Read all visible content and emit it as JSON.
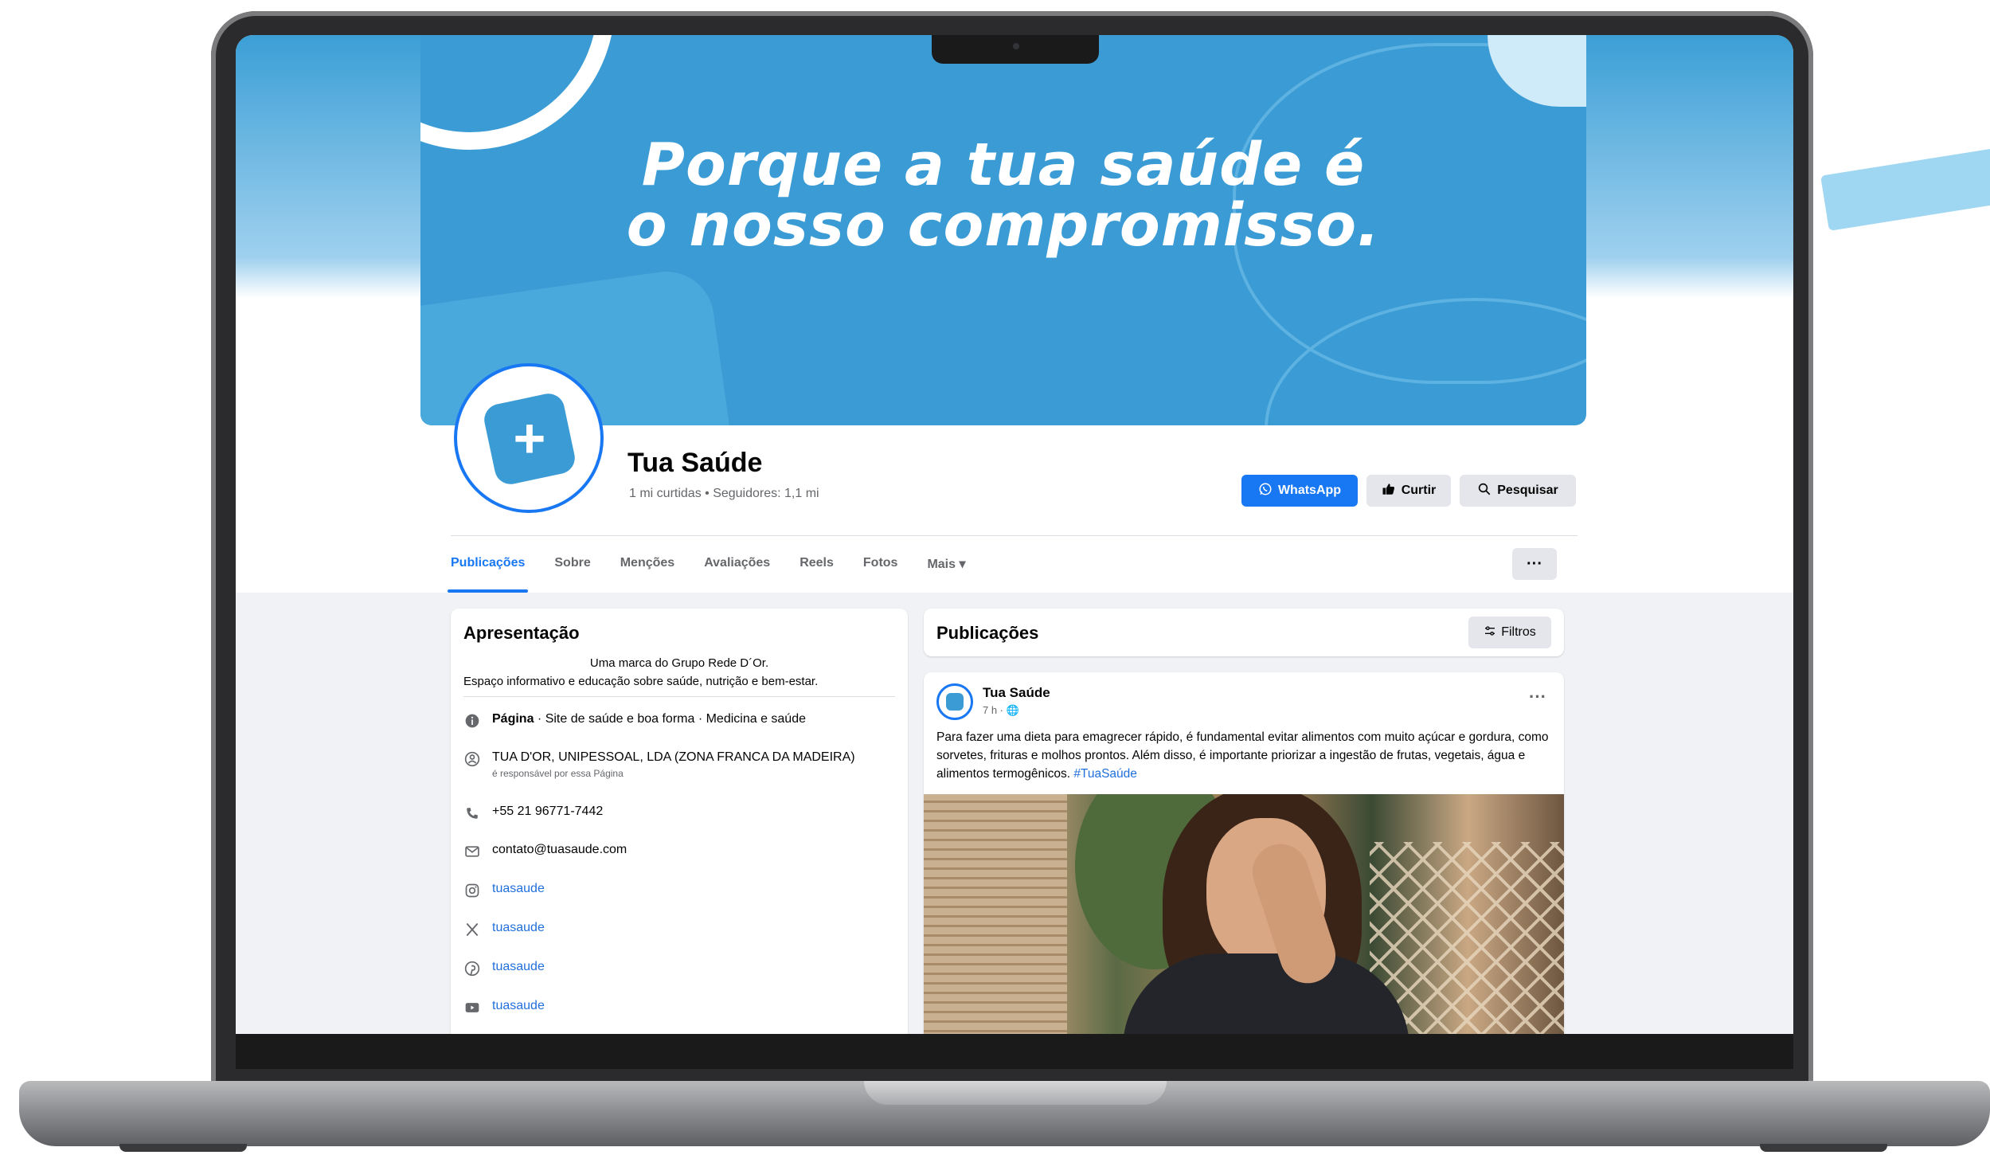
{
  "cover": {
    "headline_line1": "Porque a tua saúde é",
    "headline_line2": "o nosso compromisso."
  },
  "profile": {
    "name": "Tua Saúde",
    "stats": "1 mi curtidas • Seguidores: 1,1 mi",
    "avatar_icon": "plus-icon"
  },
  "actions": {
    "whatsapp": "WhatsApp",
    "curtir": "Curtir",
    "pesquisar": "Pesquisar",
    "whatsapp_color": "#1877f2"
  },
  "tabs": [
    {
      "label": "Publicações",
      "active": true
    },
    {
      "label": "Sobre"
    },
    {
      "label": "Menções"
    },
    {
      "label": "Avaliações"
    },
    {
      "label": "Reels"
    },
    {
      "label": "Fotos"
    },
    {
      "label": "Mais ▾"
    }
  ],
  "tabs_more": "···",
  "intro": {
    "title": "Apresentação",
    "bio_line1": "Uma marca do Grupo Rede D´Or.",
    "bio_line2": "Espaço informativo e educação sobre saúde, nutrição e bem-estar.",
    "page_label": "Página",
    "page_category": " · Site de saúde e boa forma · Medicina e saúde",
    "company": "TUA D'OR, UNIPESSOAL, LDA (ZONA FRANCA DA MADEIRA)",
    "company_sub": "é responsável por essa Página",
    "phone": "+55 21 96771-7442",
    "email": "contato@tuasaude.com",
    "instagram": "tuasaude",
    "x": "tuasaude",
    "pinterest": "tuasaude",
    "youtube": "tuasaude"
  },
  "posts": {
    "title": "Publicações",
    "filter_label": "Filtros",
    "post": {
      "author": "Tua Saúde",
      "time": "7 h · 🌐",
      "text": "Para fazer uma dieta para emagrecer rápido, é fundamental evitar alimentos com muito açúcar e gordura, como sorvetes, frituras e molhos prontos. Além disso, é importante priorizar a ingestão de frutas, vegetais, água e alimentos termogênicos. ",
      "hashtag": "#TuaSaúde",
      "more": "···"
    }
  }
}
